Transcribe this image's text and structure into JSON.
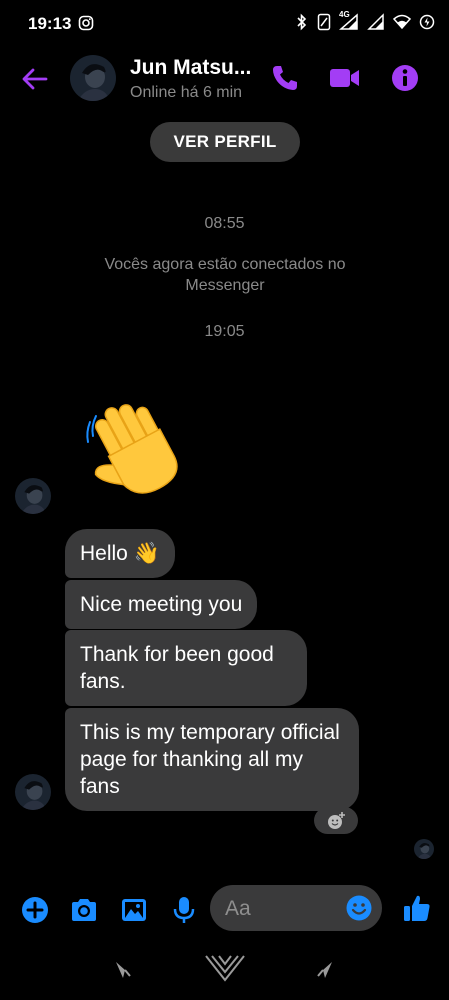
{
  "status_bar": {
    "time": "19:13",
    "network": "4G"
  },
  "header": {
    "contact_name": "Jun Matsu...",
    "contact_status": "Online há 6 min"
  },
  "profile_button": {
    "label": "VER PERFIL"
  },
  "conversation": {
    "timestamp_1": "08:55",
    "system_message": "Vocês agora estão conectados no Messenger",
    "timestamp_2": "19:05",
    "messages": [
      {
        "text": "Hello 👋"
      },
      {
        "text": "Nice meeting you"
      },
      {
        "text": "Thank for been good fans."
      },
      {
        "text": "This is my temporary official page for thanking all my fans"
      }
    ]
  },
  "composer": {
    "placeholder": "Aa"
  },
  "colors": {
    "accent_purple": "#a33df5",
    "accent_blue": "#1a8cff",
    "bubble": "#3a3a3b",
    "muted_text": "#8a8a8a"
  }
}
